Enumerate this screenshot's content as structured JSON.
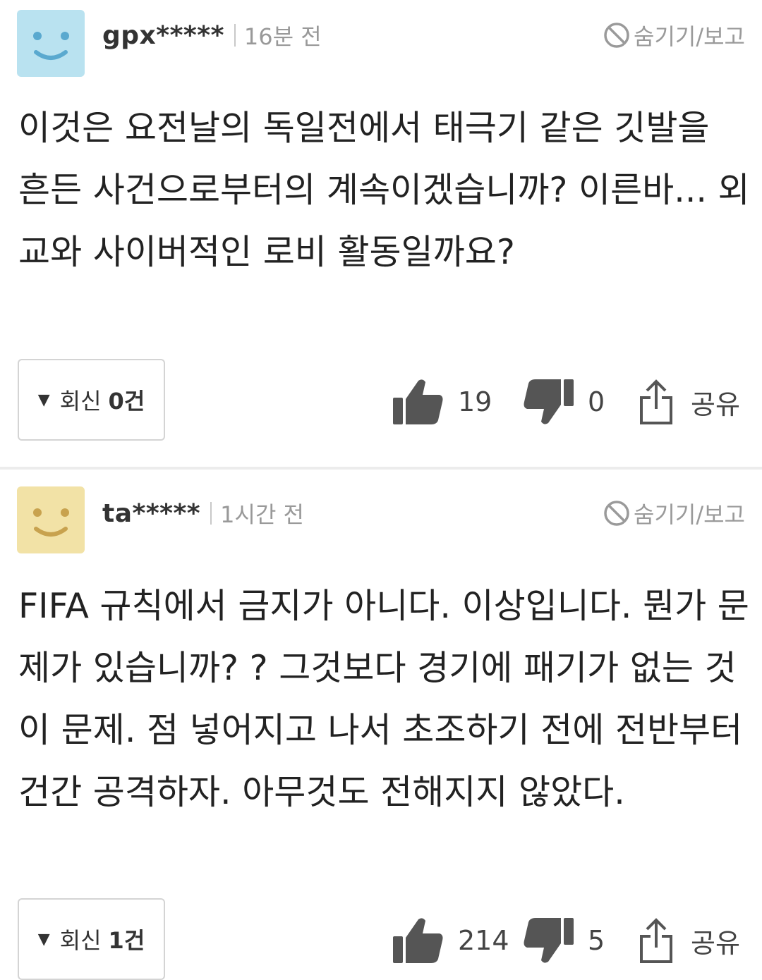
{
  "comments": [
    {
      "username": "gpx*****",
      "time": "16분 전",
      "hide_report": "숨기기/보고",
      "text": "이것은 요전날의 독일전에서 태극기 같은 깃발을 흔든 사건으로부터의 계속이겠습니까? 이른바... 외교와 사이버적인 로비 활동일까요?",
      "reply_label": "회신",
      "reply_count": "0건",
      "likes": "19",
      "dislikes": "0",
      "share_label": "공유",
      "avatar_color": "#b9e2f0",
      "avatar_face_color": "#5aa9cf"
    },
    {
      "username": "ta*****",
      "time": "1시간 전",
      "hide_report": "숨기기/보고",
      "text": "FIFA 규칙에서 금지가 아니다. 이상입니다. 뭔가 문제가 있습니까? ? 그것보다 경기에 패기가 없는 것이 문제. 점 넣어지고 나서 초조하기 전에 전반부터 건간 공격하자. 아무것도 전해지지 않았다.",
      "reply_label": "회신",
      "reply_count": "1건",
      "likes": "214",
      "dislikes": "5",
      "share_label": "공유",
      "avatar_color": "#f2e2a6",
      "avatar_face_color": "#c8a24e"
    }
  ]
}
